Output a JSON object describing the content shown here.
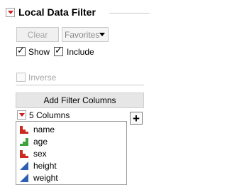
{
  "header": {
    "title": "Local Data Filter"
  },
  "toolbar": {
    "clear_label": "Clear",
    "favorites_label": "Favorites"
  },
  "options": {
    "show_label": "Show",
    "show_checked": true,
    "include_label": "Include",
    "include_checked": true,
    "inverse_label": "Inverse",
    "inverse_checked": false
  },
  "add_filter_columns_label": "Add Filter Columns",
  "columns": {
    "count_label": "5 Columns",
    "items": [
      {
        "label": "name",
        "icon": "nominal-icon"
      },
      {
        "label": "age",
        "icon": "ordinal-icon"
      },
      {
        "label": "sex",
        "icon": "nominal-icon"
      },
      {
        "label": "height",
        "icon": "continuous-icon"
      },
      {
        "label": "weight",
        "icon": "continuous-icon"
      }
    ]
  },
  "colors": {
    "nominal": "#cc2a1f",
    "ordinal": "#3ea33e",
    "continuous": "#2d5fb3",
    "arrow": "#cc1f1f"
  }
}
